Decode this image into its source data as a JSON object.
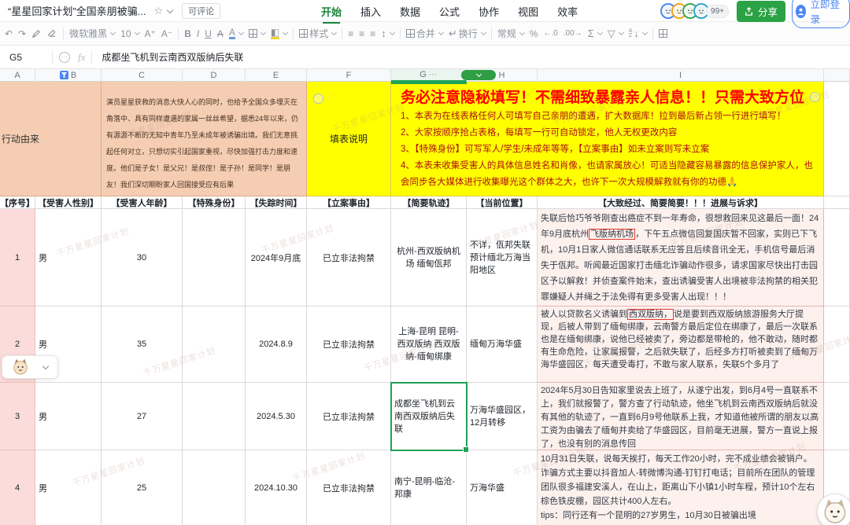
{
  "colors": {
    "accent_green": "#2ba245",
    "selection_green": "#1fa258",
    "annotation_red": "#e03a2f",
    "notice_yellow": "#ffff00",
    "notice_title_red": "#ff0000",
    "peach": "#f4cdb3",
    "pink": "#fbdcda",
    "collab_blue": "#4a86f5"
  },
  "titlebar": {
    "title": "“星星回家计划”全国亲朋被骗...",
    "comment_badge": "可评论",
    "menus": [
      "开始",
      "插入",
      "数据",
      "公式",
      "协作",
      "视图",
      "效率"
    ],
    "collab_overflow": "99+",
    "share_label": "分享",
    "login_label": "立即登录"
  },
  "toolbar": {
    "font_name": "微软雅黑",
    "font_size": "10",
    "style_label": "样式",
    "merge_label": "合并",
    "wrap_label": "换行",
    "number_format": "常规"
  },
  "formula_bar": {
    "cell_ref": "G5",
    "fx_label": "fx",
    "value": "成都坐飞机到云南西双版纳后失联"
  },
  "column_headers": [
    "A",
    "B",
    "C",
    "D",
    "E",
    "F",
    "G",
    "H",
    "I"
  ],
  "watermark": "千万星星回家计划",
  "sheet": {
    "row1": {
      "origin_label": "行动由来",
      "intro": "演员星星获救的消息大快人心的同时，也给予全国众多埋灭在角落中、具有同样遭遇的家属一丝丝希望，据悉24年以来，仍有源源不断的无知中青年乃至未成年被诱骗出境。我们无意挑起任何对立，只想切实引起国家重视，尽快加强打击力度和速度。他们是子女！是父兄！是叔侄！是子孙！是同学！是朋友！我们深切期盼家人回国接受应有后果",
      "form_note_label": "填表说明",
      "notice_title": "务必注意隐秘填写！不需细致暴露亲人信息！！只需大致方位",
      "notice_lines": [
        "1、本表为在线表格任何人可填写自己亲朋的遭遇，扩大数据库！拉到最后新占领一行进行填写！",
        "2、大家按顺序抢占表格，每填写一行可自动锁定，他人无权更改内容",
        "3、【特殊身份】可写军人/学生/未成年等等，【立案事由】如未立案则写未立案",
        "4、本表未收集受害人的具体信息姓名和肖像，也请家属放心！可适当隐藏容易暴露的信息保护家人，也会同步各大媒体进行收集曝光这个群体之大，也许下一次大规模解救就有你的功德🙏"
      ]
    },
    "field_headers": [
      "【序号】",
      "【受害人性别】",
      "【受害人年龄】",
      "【特殊身份】",
      "【失踪时间】",
      "【立案事由】",
      "【简要轨迹】",
      "【当前位置】",
      "【大致经过、简要简要！！！进展与诉求】"
    ],
    "rows": [
      {
        "no": "1",
        "gender": "男",
        "age": "30",
        "special": "",
        "missing_time": "2024年9月底",
        "case_status": "已立非法拘禁",
        "route": "杭州-西双版纳机场 缅甸佤邦",
        "location": "不详，佤邦失联预计缅北万海当阳地区",
        "detail_pre": "失联后恰巧爷爷刚查出癌症不到一年寿命，很想救回来见这最后一面！24年9月底杭州",
        "detail_boxed": "飞版纳机场",
        "detail_post": "，下午五点微信回复国庆暂不回家，实则已下飞机，10月1日家人微信通话联系无应答且后续音讯全无，手机信号最后消失于佤邦。听闻最近国家打击缅北诈骗动作很多，请求国家尽快出打击园区予以解救！并侦查案件始末，查出诱骗受害人出境被非法拘禁的相关犯罪嫌疑人并绳之于法免得有更多受害人出现！！！"
      },
      {
        "no": "2",
        "gender": "男",
        "age": "35",
        "special": "",
        "missing_time": "2024.8.9",
        "case_status": "已立非法拘禁",
        "route": "上海-昆明 昆明-西双版纳 西双版纳-缅甸绑康",
        "location": "缅甸万海华盛",
        "detail_pre": "被人以贷款名义诱骗到",
        "detail_boxed": "西双版纳，",
        "detail_post": "说是要到西双版纳旅游服务大厅提现，后被人带到了缅甸绑康，云南警方最后定位在绑康了，最后一次联系也是在缅甸绑康，说他已经被卖了，旁边都是带枪的，他不敢动，随时都有生命危险，让家属报警，之后就失联了，后经多方打听被卖到了缅甸万海华盛园区，每天遭受毒打，不敢与家人联系，失联5个多月了"
      },
      {
        "no": "3",
        "gender": "男",
        "age": "27",
        "special": "",
        "missing_time": "2024.5.30",
        "case_status": "已立非法拘禁",
        "route": "成都坐飞机到云南西双版纳后失联",
        "location": "万海华盛园区，12月转移",
        "detail_pre": "",
        "detail_boxed": "",
        "detail_post": "2024年5月30日告知家里说去上班了，从遂宁出发，到6月4号一直联系不上，我们就报警了，警方查了行动轨迹，他坐飞机到云南西双版纳后就没有其他的轨迹了，一直到6月9号他联系上我，才知道他被所谓的朋友以高工资为由骗去了缅甸并卖给了华盛园区，目前毫无进展，警方一直说上报了，也没有别的消息传回"
      },
      {
        "no": "4",
        "gender": "男",
        "age": "25",
        "special": "",
        "missing_time": "2024.10.30",
        "case_status": "已立非法拘禁",
        "route": "南宁-昆明-临沧-邦康",
        "location": "万海华盛",
        "detail_pre": "",
        "detail_boxed": "",
        "detail_post": "10月31日失联，说每天挨打，每天工作20小时，完不成业绩会被销户。诈骗方式主要以抖音加人-转微博沟通-钉钉打电话；目前所在团队的管理团队很多福建安溪人，在山上，距离山下小镇1小时车程，预计10个左右棕色铁皮棚，园区共计400人左右。\ntips：同行还有一个昆明的27岁男生，10月30日被骗出境"
      }
    ]
  }
}
